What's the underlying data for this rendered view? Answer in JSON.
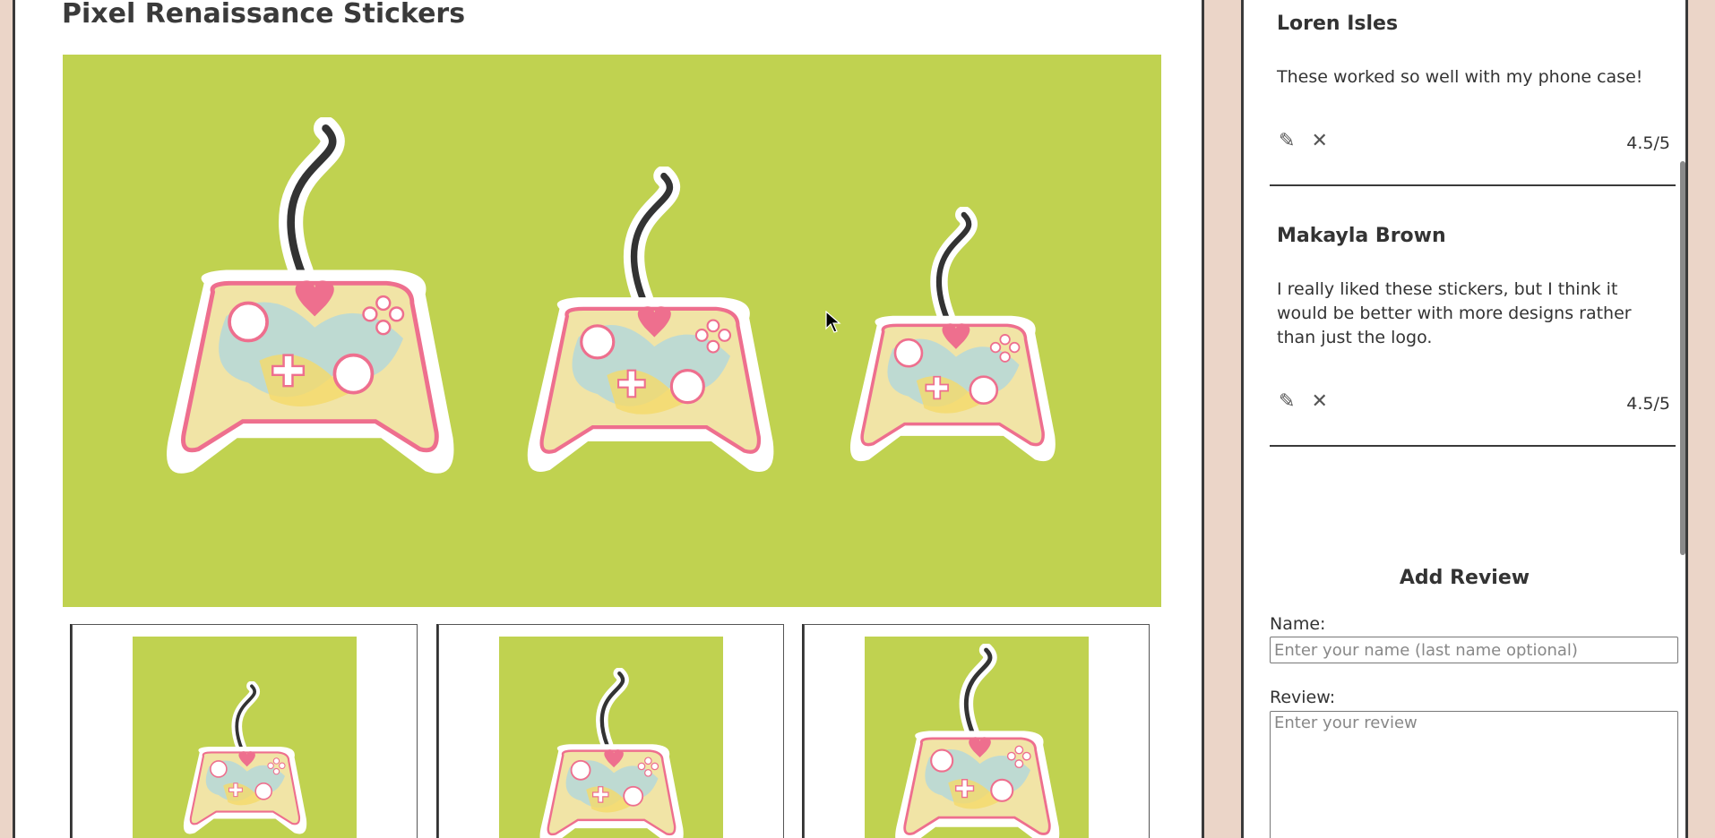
{
  "product": {
    "title": "Pixel Renaissance Stickers"
  },
  "reviews": [
    {
      "name": "Loren Isles",
      "text": "These worked so well with my phone case!",
      "edit_icon": "✎",
      "delete_icon": "✕",
      "rating": "4.5/5"
    },
    {
      "name": "Makayla Brown",
      "text": "I really liked these stickers, but I think it would be better with more designs rather than just the logo.",
      "edit_icon": "✎",
      "delete_icon": "✕",
      "rating": "4.5/5"
    }
  ],
  "add_review": {
    "title": "Add Review",
    "name_label": "Name:",
    "name_placeholder": "Enter your name (last name optional)",
    "review_label": "Review:",
    "review_placeholder": "Enter your review"
  },
  "colors": {
    "page_bg": "#ebd5c8",
    "image_bg": "#c0d250",
    "controller_outline": "#ee6f8e"
  }
}
